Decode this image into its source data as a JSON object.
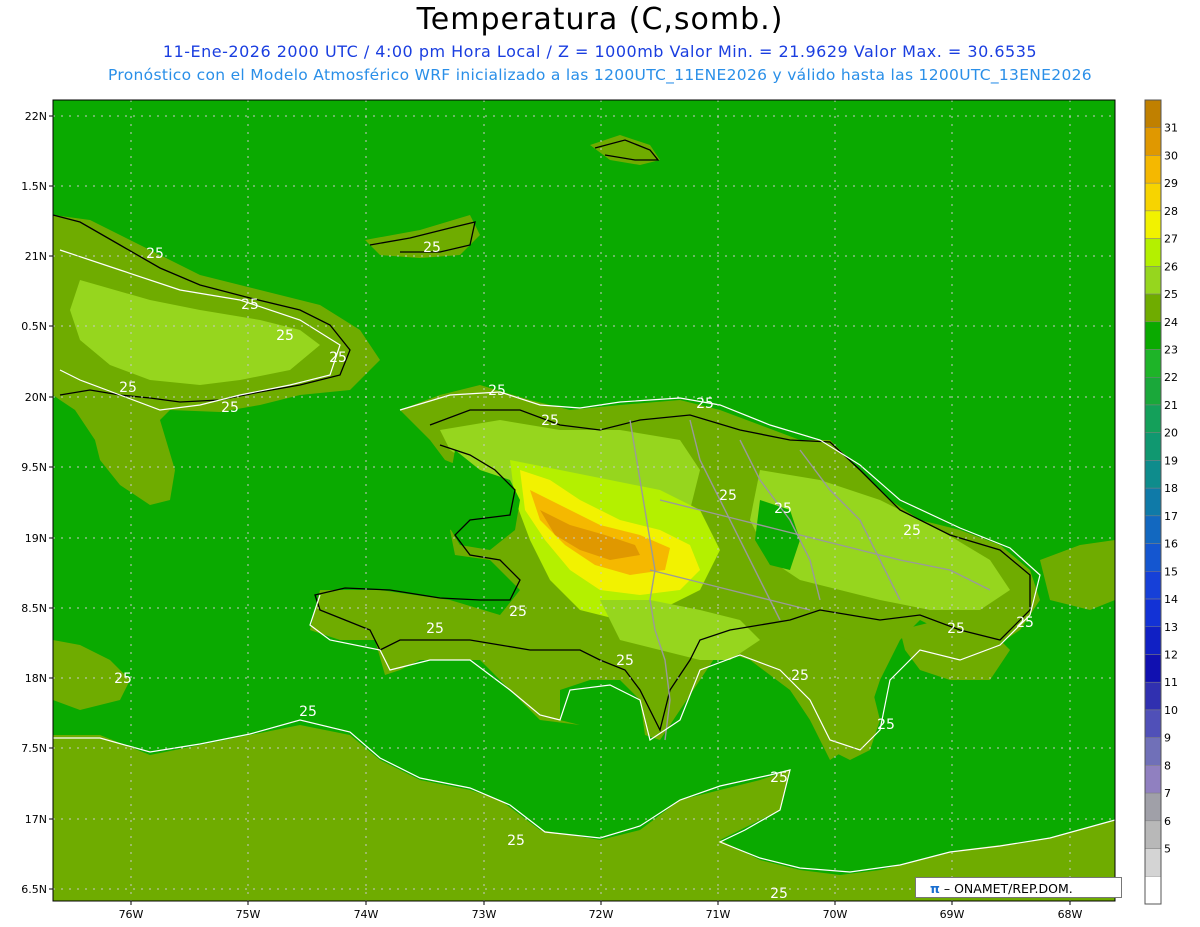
{
  "title": "Temperatura (C,somb.)",
  "subtitle_line1": "11-Ene-2026 2000 UTC / 4:00 pm Hora Local / Z = 1000mb   Valor Min. = 21.9629  Valor Max. = 30.6535",
  "subtitle_line2": "Pronóstico con el Modelo Atmosférico WRF inicializado a las 1200UTC_11ENE2026 y válido hasta las  1200UTC_13ENE2026",
  "lat_labels": [
    "22N",
    "1.5N",
    "21N",
    "0.5N",
    "20N",
    "9.5N",
    "19N",
    "8.5N",
    "18N",
    "7.5N",
    "17N",
    "6.5N"
  ],
  "lon_labels": [
    "76W",
    "75W",
    "74W",
    "73W",
    "72W",
    "71W",
    "70W",
    "69W",
    "68W"
  ],
  "contour_label": "25",
  "colorbar_labels": [
    "31",
    "30",
    "29",
    "28",
    "27",
    "26",
    "25",
    "24",
    "23",
    "22",
    "21",
    "20",
    "19",
    "18",
    "17",
    "16",
    "15",
    "14",
    "13",
    "12",
    "11",
    "10",
    "9",
    "8",
    "7",
    "6",
    "5"
  ],
  "colorbar_colors": [
    "#c08000",
    "#e09800",
    "#f5b800",
    "#f7d400",
    "#f2f200",
    "#b4f000",
    "#96d61e",
    "#6fac00",
    "#0aaa00",
    "#1eb428",
    "#1aa83a",
    "#14a05a",
    "#109870",
    "#0e8c8c",
    "#0f7aa8",
    "#1268c0",
    "#1456d0",
    "#1640d8",
    "#1232d6",
    "#1020c4",
    "#1010b0",
    "#3030b0",
    "#5050b8",
    "#7070b8",
    "#9080c0",
    "#a0a0a8",
    "#b8b8b8",
    "#d4d4d4",
    "#ffffff"
  ],
  "credit": {
    "logo": "π",
    "text": "– ONAMET/REP.DOM."
  },
  "colors": {
    "sea": "#0aaa00",
    "land": "#6fac00",
    "warm1": "#96d61e",
    "warm2": "#b4f000",
    "hot1": "#f2f200",
    "hot2": "#f5b800",
    "hot3": "#e09800"
  }
}
